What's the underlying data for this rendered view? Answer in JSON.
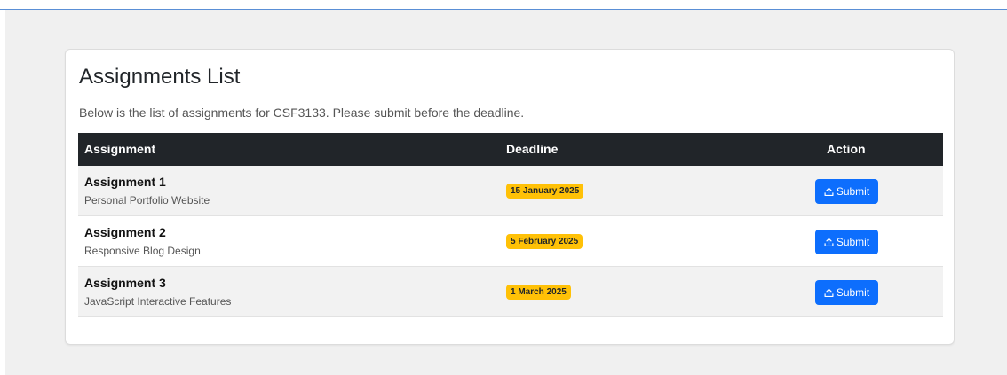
{
  "card": {
    "title": "Assignments List",
    "intro": "Below is the list of assignments for CSF3133. Please submit before the deadline."
  },
  "table": {
    "headers": {
      "assignment": "Assignment",
      "deadline": "Deadline",
      "action": "Action"
    },
    "rows": [
      {
        "title": "Assignment 1",
        "subtitle": "Personal Portfolio Website",
        "deadline": "15 January 2025",
        "action_label": "Submit"
      },
      {
        "title": "Assignment 2",
        "subtitle": "Responsive Blog Design",
        "deadline": "5 February 2025",
        "action_label": "Submit"
      },
      {
        "title": "Assignment 3",
        "subtitle": "JavaScript Interactive Features",
        "deadline": "1 March 2025",
        "action_label": "Submit"
      }
    ]
  },
  "icons": {
    "submit": "upload-icon"
  },
  "colors": {
    "header_bg": "#212529",
    "badge_bg": "#ffc107",
    "button_bg": "#0d6efd",
    "page_bg": "#f0f0f0"
  }
}
